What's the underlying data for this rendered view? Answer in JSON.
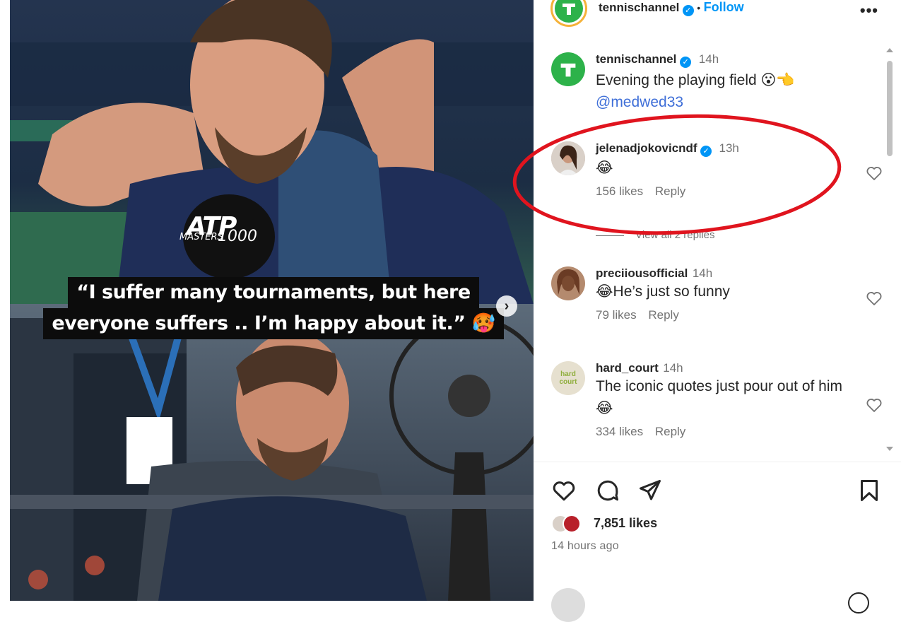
{
  "post": {
    "author": "tennischannel",
    "follow_label": "Follow",
    "dot": "•",
    "more_label": "•••",
    "caption_time": "14h",
    "caption_text": "Evening the playing field 😮👈",
    "caption_mention": "@medwed33"
  },
  "media": {
    "quote_line1": "“I suffer many tournaments, but here",
    "quote_line2": "everyone suffers .. I’m happy about it.” 🥵",
    "mic_brand": "ATP",
    "mic_sub": "MASTERS",
    "mic_number": "1000",
    "next_icon": "›"
  },
  "comments": [
    {
      "username": "jelenadjokovicndf",
      "verified": true,
      "time": "13h",
      "text": "😂",
      "likes": "156 likes",
      "reply": "Reply",
      "view_replies": "View all 2 replies"
    },
    {
      "username": "preciiousofficial",
      "verified": false,
      "time": "14h",
      "text": "😂He’s just so funny",
      "likes": "79 likes",
      "reply": "Reply"
    },
    {
      "username": "hard_court",
      "verified": false,
      "time": "14h",
      "text": "The iconic quotes just pour out of him 😂",
      "likes": "334 likes",
      "reply": "Reply",
      "avatar_text": "hard court"
    }
  ],
  "footer": {
    "likes_count": "7,851 likes",
    "time_ago": "14 hours ago"
  },
  "icons": {
    "like": "heart-icon",
    "comment": "comment-icon",
    "share": "share-icon",
    "save": "bookmark-icon"
  },
  "colors": {
    "brand_green": "#2db24a",
    "link_blue": "#0095f6",
    "highlight_red": "#e0141e"
  }
}
